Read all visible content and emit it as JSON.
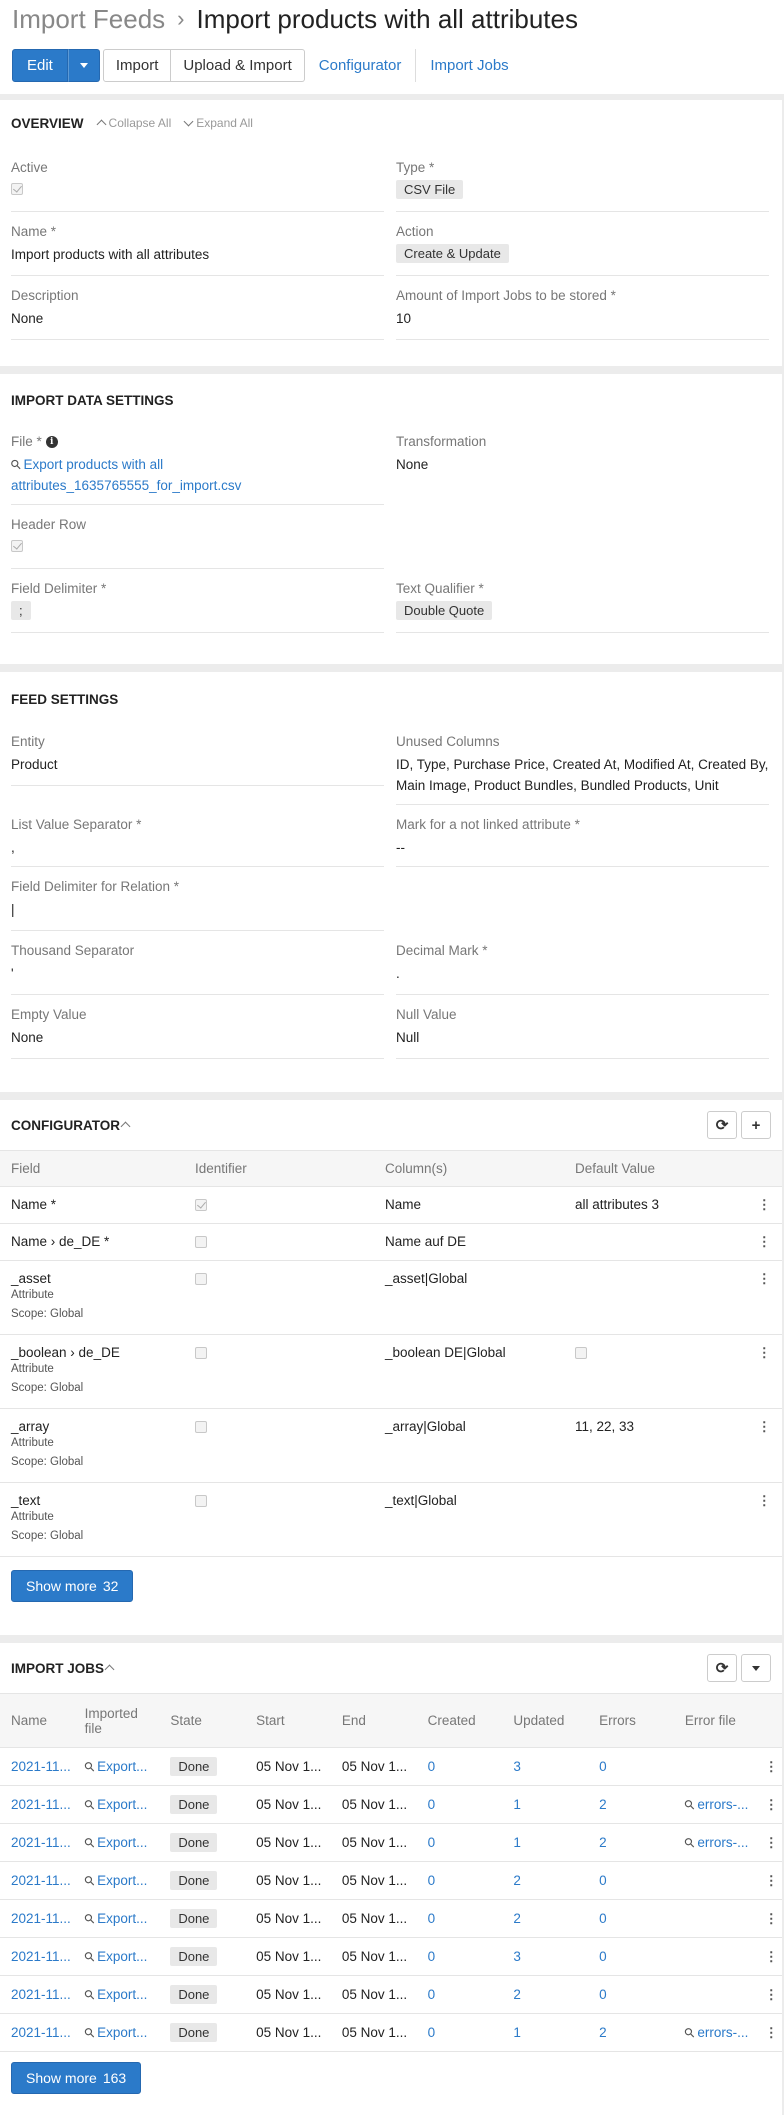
{
  "breadcrumb": {
    "parent": "Import Feeds",
    "title": "Import products with all attributes"
  },
  "actions": {
    "edit": "Edit",
    "import": "Import",
    "upload_import": "Upload & Import",
    "configurator": "Configurator",
    "import_jobs": "Import Jobs"
  },
  "overview": {
    "title": "OVERVIEW",
    "collapse_all": "Collapse All",
    "expand_all": "Expand All",
    "active_label": "Active",
    "type_label": "Type *",
    "type_value": "CSV File",
    "name_label": "Name *",
    "name_value": "Import products with all attributes",
    "action_label": "Action",
    "action_value": "Create & Update",
    "description_label": "Description",
    "description_value": "None",
    "amount_label": "Amount of Import Jobs to be stored *",
    "amount_value": "10"
  },
  "import_data": {
    "title": "IMPORT DATA SETTINGS",
    "file_label": "File *",
    "file_value": "Export products with all attributes_1635765555_for_import.csv",
    "transformation_label": "Transformation",
    "transformation_value": "None",
    "header_row_label": "Header Row",
    "delimiter_label": "Field Delimiter *",
    "delimiter_value": ";",
    "qualifier_label": "Text Qualifier *",
    "qualifier_value": "Double Quote"
  },
  "feed_settings": {
    "title": "FEED SETTINGS",
    "entity_label": "Entity",
    "entity_value": "Product",
    "unused_label": "Unused Columns",
    "unused_value": "ID, Type, Purchase Price, Created At, Modified At, Created By, Main Image, Product Bundles, Bundled Products, Unit",
    "list_sep_label": "List Value Separator *",
    "list_sep_value": ",",
    "mark_label": "Mark for a not linked attribute *",
    "mark_value": "--",
    "rel_delim_label": "Field Delimiter for Relation *",
    "rel_delim_value": "|",
    "thousand_label": "Thousand Separator",
    "thousand_value": "'",
    "decimal_label": "Decimal Mark *",
    "decimal_value": ".",
    "empty_label": "Empty Value",
    "empty_value": "None",
    "null_label": "Null Value",
    "null_value": "Null"
  },
  "configurator": {
    "title": "CONFIGURATOR",
    "columns": [
      "Field",
      "Identifier",
      "Column(s)",
      "Default Value"
    ],
    "rows": [
      {
        "field": "Name *",
        "sub1": "",
        "sub2": "",
        "identifier": true,
        "column": "Name",
        "default": "all attributes 3",
        "default_cb": false
      },
      {
        "field": "Name › de_DE *",
        "sub1": "",
        "sub2": "",
        "identifier": false,
        "column": "Name auf DE",
        "default": "",
        "default_cb": false
      },
      {
        "field": "_asset",
        "sub1": "Attribute",
        "sub2": "Scope: Global",
        "identifier": false,
        "column": "_asset|Global",
        "default": "",
        "default_cb": false
      },
      {
        "field": "_boolean › de_DE",
        "sub1": "Attribute",
        "sub2": "Scope: Global",
        "identifier": false,
        "column": "_boolean DE|Global",
        "default": "",
        "default_cb": true
      },
      {
        "field": "_array",
        "sub1": "Attribute",
        "sub2": "Scope: Global",
        "identifier": false,
        "column": "_array|Global",
        "default": "11, 22, 33",
        "default_cb": false
      },
      {
        "field": "_text",
        "sub1": "Attribute",
        "sub2": "Scope: Global",
        "identifier": false,
        "column": "_text|Global",
        "default": "",
        "default_cb": false
      }
    ],
    "show_more": "Show more",
    "show_more_count": "32"
  },
  "import_jobs": {
    "title": "IMPORT JOBS",
    "columns": [
      "Name",
      "Imported file",
      "State",
      "Start",
      "End",
      "Created",
      "Updated",
      "Errors",
      "Error file"
    ],
    "rows": [
      {
        "name": "2021-11...",
        "file": "Export...",
        "state": "Done",
        "start": "05 Nov 1...",
        "end": "05 Nov 1...",
        "created": "0",
        "updated": "3",
        "errors": "0",
        "error_file": ""
      },
      {
        "name": "2021-11...",
        "file": "Export...",
        "state": "Done",
        "start": "05 Nov 1...",
        "end": "05 Nov 1...",
        "created": "0",
        "updated": "1",
        "errors": "2",
        "error_file": "errors-..."
      },
      {
        "name": "2021-11...",
        "file": "Export...",
        "state": "Done",
        "start": "05 Nov 1...",
        "end": "05 Nov 1...",
        "created": "0",
        "updated": "1",
        "errors": "2",
        "error_file": "errors-..."
      },
      {
        "name": "2021-11...",
        "file": "Export...",
        "state": "Done",
        "start": "05 Nov 1...",
        "end": "05 Nov 1...",
        "created": "0",
        "updated": "2",
        "errors": "0",
        "error_file": ""
      },
      {
        "name": "2021-11...",
        "file": "Export...",
        "state": "Done",
        "start": "05 Nov 1...",
        "end": "05 Nov 1...",
        "created": "0",
        "updated": "2",
        "errors": "0",
        "error_file": ""
      },
      {
        "name": "2021-11...",
        "file": "Export...",
        "state": "Done",
        "start": "05 Nov 1...",
        "end": "05 Nov 1...",
        "created": "0",
        "updated": "3",
        "errors": "0",
        "error_file": ""
      },
      {
        "name": "2021-11...",
        "file": "Export...",
        "state": "Done",
        "start": "05 Nov 1...",
        "end": "05 Nov 1...",
        "created": "0",
        "updated": "2",
        "errors": "0",
        "error_file": ""
      },
      {
        "name": "2021-11...",
        "file": "Export...",
        "state": "Done",
        "start": "05 Nov 1...",
        "end": "05 Nov 1...",
        "created": "0",
        "updated": "1",
        "errors": "2",
        "error_file": "errors-..."
      }
    ],
    "show_more": "Show more",
    "show_more_count": "163"
  }
}
